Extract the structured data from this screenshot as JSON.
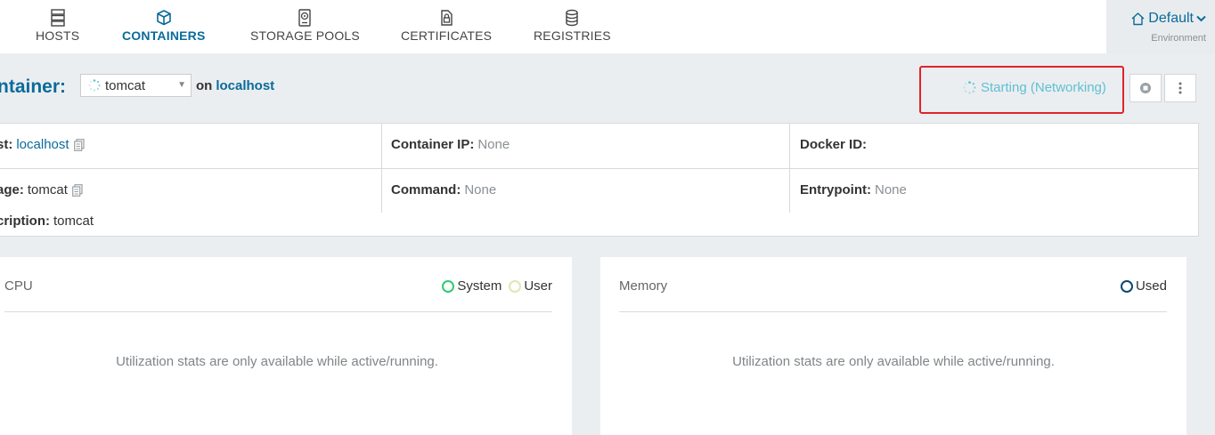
{
  "nav": {
    "items": [
      {
        "label": "HOSTS",
        "icon": "server-icon"
      },
      {
        "label": "CONTAINERS",
        "icon": "cube-icon",
        "active": true
      },
      {
        "label": "STORAGE POOLS",
        "icon": "hard-drive-icon"
      },
      {
        "label": "CERTIFICATES",
        "icon": "certificate-icon"
      },
      {
        "label": "REGISTRIES",
        "icon": "database-icon"
      }
    ],
    "environment": {
      "name": "Default",
      "label": "Environment",
      "icon": "home-icon"
    }
  },
  "header": {
    "title": "ntainer:",
    "selected_container": "tomcat",
    "on_word": "on",
    "host": "localhost",
    "state": "Starting (Networking)",
    "stop_icon": "stop-icon",
    "menu_icon": "kebab-menu-icon"
  },
  "info": {
    "host_label": "st:",
    "host_value": "localhost",
    "image_label": "age:",
    "image_value": "tomcat",
    "description_label": "cription:",
    "description_value": "tomcat",
    "container_ip_label": "Container IP:",
    "container_ip_value": "None",
    "command_label": "Command:",
    "command_value": "None",
    "docker_id_label": "Docker ID:",
    "docker_id_value": "",
    "entrypoint_label": "Entrypoint:",
    "entrypoint_value": "None"
  },
  "cpu": {
    "title": "CPU",
    "legend": [
      {
        "label": "System",
        "color": "#2ecc71"
      },
      {
        "label": "User",
        "color": "#dfe7b0"
      }
    ],
    "message": "Utilization stats are only available while active/running."
  },
  "memory": {
    "title": "Memory",
    "legend": [
      {
        "label": "Used",
        "color": "#0b4a6f"
      }
    ],
    "message": "Utilization stats are only available while active/running."
  },
  "colors": {
    "accent": "#0a6b9b",
    "state": "#5fbfd4",
    "highlight": "#e0232b"
  }
}
